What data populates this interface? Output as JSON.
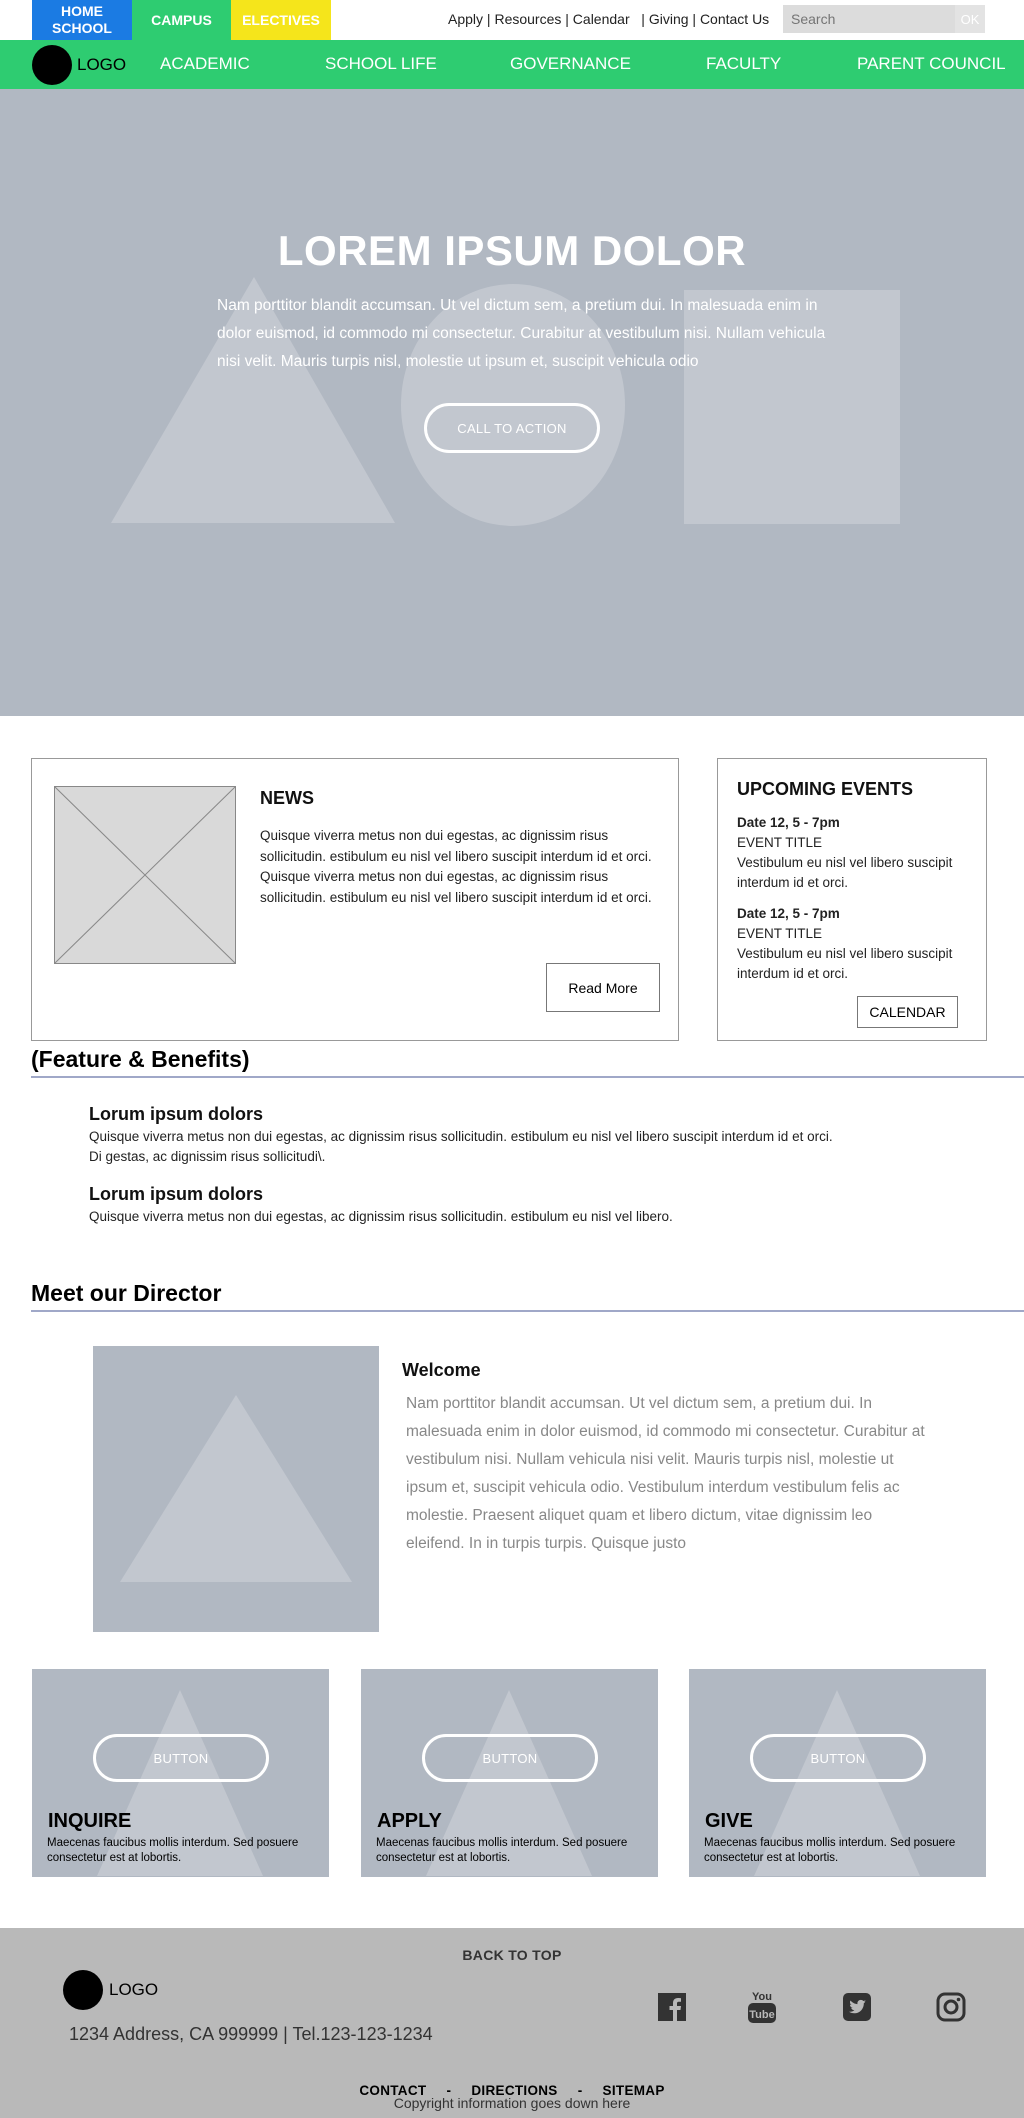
{
  "topbar": {
    "tabs": [
      {
        "line1": "HOME",
        "line2": "SCHOOL"
      },
      {
        "label": "CAMPUS"
      },
      {
        "label": "ELECTIVES"
      }
    ],
    "utility_links": [
      "Apply",
      "Resources",
      "Calendar",
      "Giving",
      "Contact Us"
    ],
    "search_placeholder": "Search",
    "search_button": "OK"
  },
  "nav": {
    "logo": "LOGO",
    "items": [
      "ACADEMIC",
      "SCHOOL LIFE",
      "GOVERNANCE",
      "FACULTY",
      "PARENT COUNCIL"
    ]
  },
  "hero": {
    "title": "LOREM IPSUM DOLOR",
    "text": "Nam porttitor blandit accumsan. Ut vel dictum sem, a pretium dui. In malesuada enim in dolor euismod, id commodo mi consectetur. Curabitur at vestibulum nisi. Nullam vehicula nisi velit. Mauris turpis nisl, molestie ut ipsum et, suscipit vehicula odio",
    "cta": "CALL TO ACTION"
  },
  "news": {
    "title": "NEWS",
    "body": "Quisque viverra metus non dui egestas, ac dignissim risus sollicitudin. estibulum eu nisl vel libero suscipit interdum id et orci. Quisque viverra metus non dui egestas, ac dignissim risus sollicitudin. estibulum eu nisl vel libero suscipit interdum id et orci.",
    "button": "Read More"
  },
  "events": {
    "title": "UPCOMING EVENTS",
    "items": [
      {
        "date": "Date 12,  5 - 7pm",
        "title": "EVENT TITLE",
        "desc": "Vestibulum eu nisl vel libero suscipit interdum id et orci."
      },
      {
        "date": "Date 12,  5 - 7pm",
        "title": "EVENT TITLE",
        "desc": "Vestibulum eu nisl vel libero suscipit interdum id et orci."
      }
    ],
    "button": "CALENDAR"
  },
  "features": {
    "heading": "(Feature & Benefits)",
    "items": [
      {
        "title": "Lorum ipsum dolors",
        "line1": "Quisque viverra metus non dui egestas, ac dignissim risus sollicitudin. estibulum eu nisl vel libero suscipit interdum id et orci.",
        "line2": "Di gestas, ac dignissim risus sollicitudi\\."
      },
      {
        "title": "Lorum ipsum dolors",
        "line1": "Quisque viverra metus non dui egestas, ac dignissim risus sollicitudin. estibulum eu nisl vel libero."
      }
    ]
  },
  "director": {
    "heading": "Meet our Director",
    "welcome": "Welcome",
    "text": "Nam porttitor blandit accumsan. Ut vel dictum sem, a pretium dui. In malesuada enim in dolor euismod, id commodo mi consectetur. Curabitur at vestibulum nisi. Nullam vehicula nisi velit. Mauris turpis nisl, molestie ut ipsum et, suscipit vehicula odio. Vestibulum interdum vestibulum felis ac molestie. Praesent aliquet quam et libero dictum, vitae dignissim leo eleifend. In in turpis turpis. Quisque justo"
  },
  "tiles": [
    {
      "button": "BUTTON",
      "title": "INQUIRE",
      "text": "Maecenas faucibus mollis interdum. Sed posuere consectetur est at lobortis."
    },
    {
      "button": "BUTTON",
      "title": "APPLY",
      "text": "Maecenas faucibus mollis interdum. Sed posuere consectetur est at lobortis."
    },
    {
      "button": "BUTTON",
      "title": "GIVE",
      "text": "Maecenas faucibus mollis interdum. Sed posuere consectetur est at lobortis."
    }
  ],
  "footer": {
    "back_to_top": "BACK TO TOP",
    "logo": "LOGO",
    "address": "1234 Address, CA 999999 |  Tel.123-123-1234",
    "social_icons": [
      "facebook-icon",
      "youtube-icon",
      "twitter-icon",
      "instagram-icon"
    ],
    "youtube_line1": "You",
    "youtube_line2": "Tube",
    "links": [
      "CONTACT",
      "DIRECTIONS",
      "SITEMAP"
    ],
    "link_separator": "-",
    "copyright": "Copyright information goes down here"
  },
  "colors": {
    "home_tab": "#1b7be3",
    "campus_tab": "#2ecc71",
    "electives_tab": "#f5e51b",
    "nav_bg": "#2ecc71",
    "placeholder_gray": "#b1b8c2",
    "footer_bg": "#b9b9b9"
  }
}
